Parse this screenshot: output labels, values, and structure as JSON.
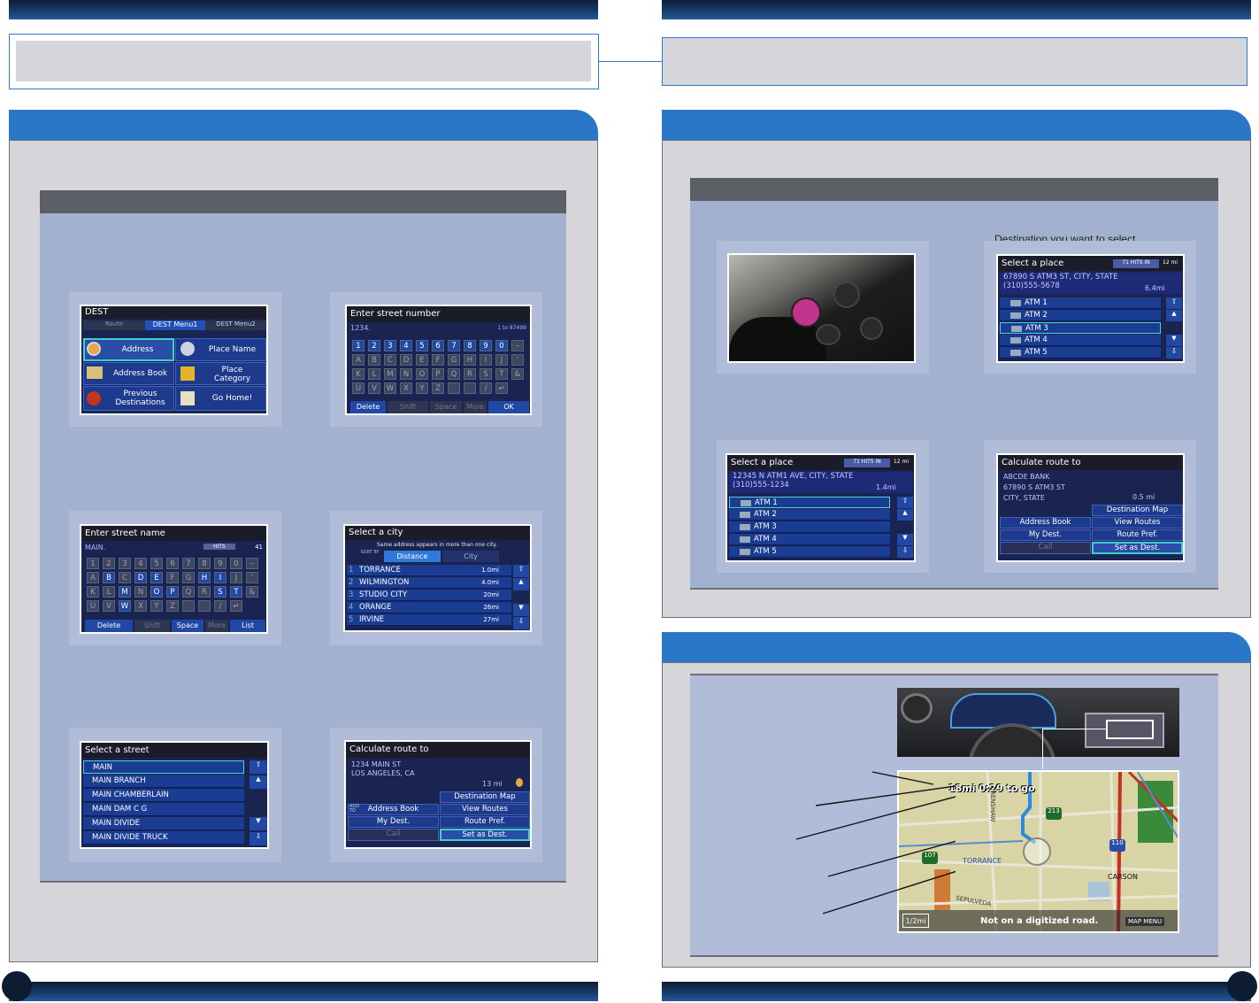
{
  "left": {
    "s1": {
      "title": "DEST",
      "tabs": [
        "Route",
        "DEST Menu1",
        "DEST Menu2"
      ],
      "items": [
        "Address",
        "Place Name",
        "Address Book",
        "Place\nCategory",
        "Previous\nDestinations",
        "Go Home!"
      ]
    },
    "s2": {
      "title": "Enter street number",
      "value": "1234.",
      "range": "1 to 87499",
      "keys1": [
        "1",
        "2",
        "3",
        "4",
        "5",
        "6",
        "7",
        "8",
        "9",
        "0",
        "–"
      ],
      "keys2": [
        "A",
        "B",
        "C",
        "D",
        "E",
        "F",
        "G",
        "H",
        "I",
        "J",
        "'"
      ],
      "keys3": [
        "K",
        "L",
        "M",
        "N",
        "O",
        "P",
        "Q",
        "R",
        "S",
        "T",
        "&"
      ],
      "keys4": [
        "U",
        "V",
        "W",
        "X",
        "Y",
        "Z",
        "",
        "",
        "/",
        "↵"
      ],
      "bottom": [
        "Delete",
        "Shift",
        "Space",
        "More",
        "OK"
      ]
    },
    "s3": {
      "title": "Enter street name",
      "value": "MAIN.",
      "hits": "HITS",
      "count": "41",
      "bottom": [
        "Delete",
        "Shift",
        "Space",
        "More",
        "List"
      ]
    },
    "s4": {
      "title": "Select a city",
      "note": "Same address appears in more than one city.",
      "sort": "SORT BY",
      "tabs": [
        "Distance",
        "City"
      ],
      "rows": [
        {
          "n": "1",
          "name": "TORRANCE",
          "d": "1.0mi"
        },
        {
          "n": "2",
          "name": "WILMINGTON",
          "d": "4.0mi"
        },
        {
          "n": "3",
          "name": "STUDIO CITY",
          "d": "20mi"
        },
        {
          "n": "4",
          "name": "ORANGE",
          "d": "26mi"
        },
        {
          "n": "5",
          "name": "IRVINE",
          "d": "27mi"
        }
      ]
    },
    "s5": {
      "title": "Select a street",
      "rows": [
        "MAIN",
        "MAIN BRANCH",
        "MAIN CHAMBERLAIN",
        "MAIN DAM C G",
        "MAIN DIVIDE",
        "MAIN DIVIDE TRUCK"
      ]
    },
    "s6": {
      "title": "Calculate route to",
      "addr1": "1234 MAIN ST",
      "addr2": "LOS ANGELES, CA",
      "dist": "13 mi",
      "add": "ADD TO",
      "b": [
        "Destination Map",
        "Address Book",
        "View Routes",
        "My Dest.",
        "Route Pref.",
        "Call",
        "Set as Dest."
      ]
    }
  },
  "right": {
    "partial_text": "Destination you want to select.",
    "p1": {
      "title": "Select a place",
      "hits": "71 HITS IN",
      "mi": "12 mi",
      "addr1": "67890 S ATM3 ST, CITY, STATE",
      "addr2": "(310)555-5678",
      "dist": "6.4mi",
      "rows": [
        "ATM 1",
        "ATM 2",
        "ATM 3",
        "ATM 4",
        "ATM 5"
      ]
    },
    "p2": {
      "title": "Select a place",
      "hits": "71 HITS IN",
      "mi": "12 mi",
      "addr1": "12345 N ATM1 AVE, CITY, STATE",
      "addr2": "(310)555-1234",
      "dist": "1.4mi",
      "rows": [
        "ATM 1",
        "ATM 2",
        "ATM 3",
        "ATM 4",
        "ATM 5"
      ]
    },
    "p3": {
      "title": "Calculate route to",
      "l1": "ABCDE BANK",
      "l2": "67890 S ATM3 ST",
      "l3": "CITY, STATE",
      "dist": "0.5 mi",
      "b": [
        "Destination Map",
        "Address Book",
        "View Routes",
        "My Dest.",
        "Route Pref.",
        "Call",
        "Set as Dest."
      ]
    },
    "map": {
      "eta": "18mi 0:29 to go",
      "scale": "1/2mi",
      "status": "Not on a digitized road.",
      "menu": "MAP MENU",
      "labels": [
        "CRENSHAW",
        "TORRANCE",
        "CARSON",
        "SEPULVEDA"
      ],
      "shields": [
        "213",
        "107",
        "110"
      ]
    }
  }
}
